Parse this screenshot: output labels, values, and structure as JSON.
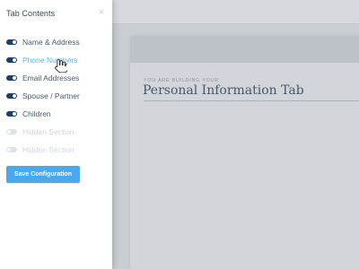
{
  "sidebar": {
    "title": "Tab Contents",
    "close_icon": "×",
    "items": [
      {
        "label": "Name & Address",
        "enabled": true,
        "state": "normal"
      },
      {
        "label": "Phone Numbers",
        "enabled": true,
        "state": "hover"
      },
      {
        "label": "Email Addresses",
        "enabled": true,
        "state": "normal"
      },
      {
        "label": "Spouse / Partner",
        "enabled": true,
        "state": "normal"
      },
      {
        "label": "Children",
        "enabled": true,
        "state": "normal"
      },
      {
        "label": "Hidden Section",
        "enabled": false,
        "state": "disabled"
      },
      {
        "label": "Hidden Section",
        "enabled": false,
        "state": "disabled"
      }
    ],
    "save_button": "Save Configuration"
  },
  "main": {
    "eyebrow": "YOU ARE BUILDING YOUR",
    "title": "Personal Information Tab"
  },
  "colors": {
    "toggle_on": "#1f3f63",
    "hover_text": "#5ab6ee",
    "button": "#4aa8ec",
    "background": "#c9ced3"
  }
}
